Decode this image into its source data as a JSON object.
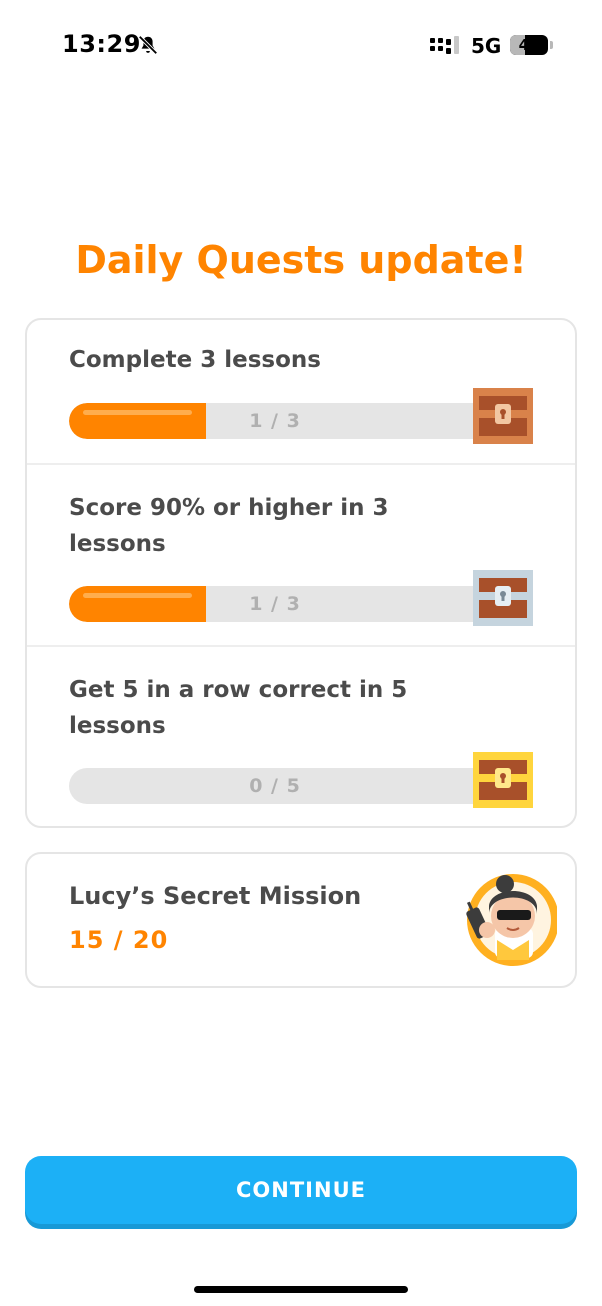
{
  "status_bar": {
    "time": "13:29",
    "network": "5G",
    "battery_percent": 40,
    "battery_label": "40",
    "icons": [
      "bell-slash-icon",
      "signal-icon"
    ]
  },
  "title": "Daily Quests update!",
  "quests": [
    {
      "label": "Complete 3 lessons",
      "progress_text": "1 / 3",
      "progress": 0.333,
      "chest": "bronze-chest-icon",
      "chest_color": "#d9824a"
    },
    {
      "label": "Score 90% or higher in 3 lessons",
      "progress_text": "1 / 3",
      "progress": 0.333,
      "chest": "silver-chest-icon",
      "chest_color": "#c5d4de"
    },
    {
      "label": "Get 5 in a row correct in 5 lessons",
      "progress_text": "0 / 5",
      "progress": 0.0,
      "chest": "gold-chest-icon",
      "chest_color": "#ffd53d"
    }
  ],
  "mission": {
    "title": "Lucy’s Secret Mission",
    "progress_text": "15  / 20",
    "avatar": "lucy-avatar-icon"
  },
  "continue_label": "CONTINUE",
  "colors": {
    "accent": "#ff8400",
    "button": "#1cb0f6",
    "text": "#4b4b4b"
  }
}
